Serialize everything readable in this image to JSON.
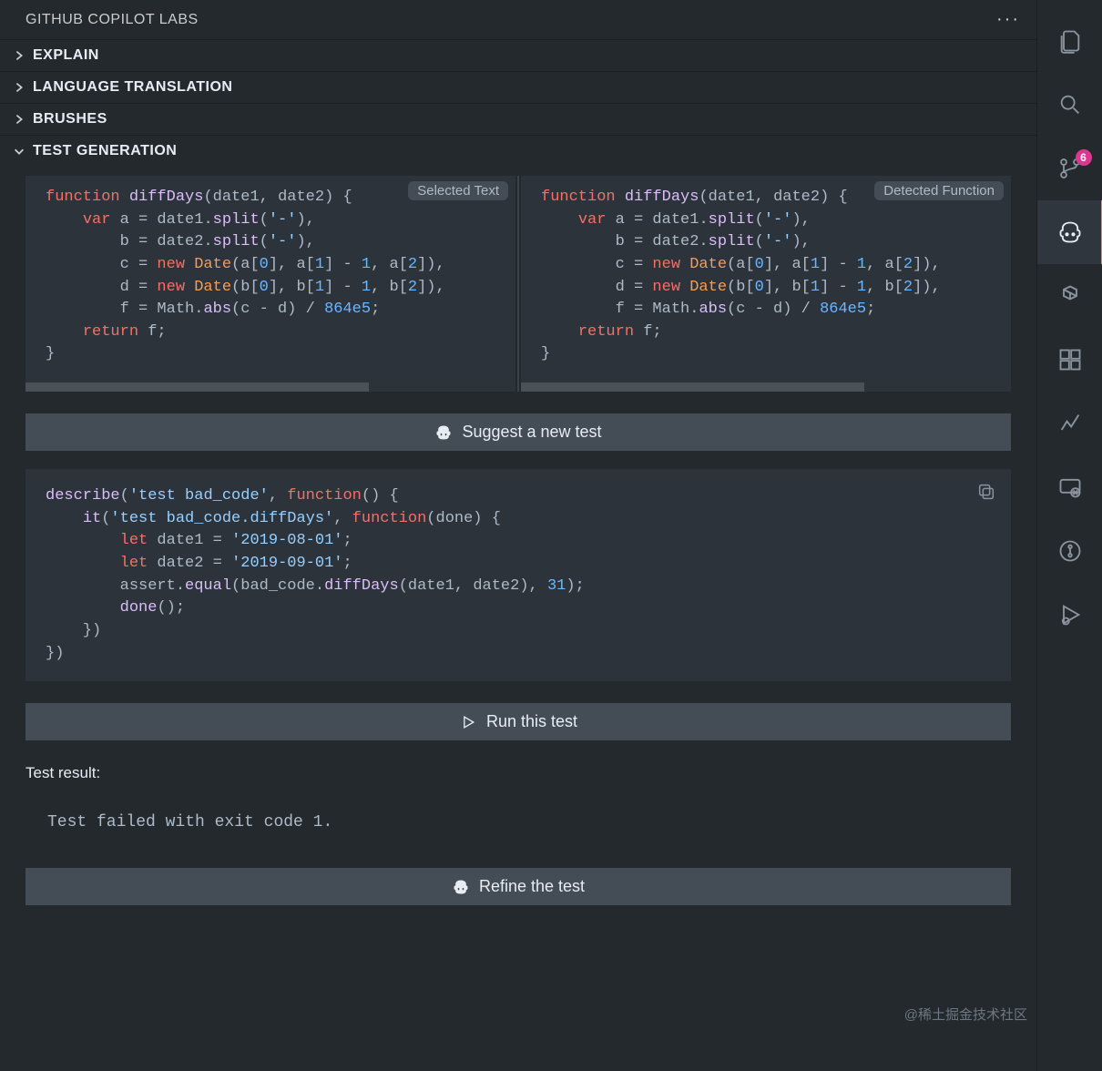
{
  "header": {
    "title": "GITHUB COPILOT LABS"
  },
  "sections": {
    "explain": "EXPLAIN",
    "language_translation": "LANGUAGE TRANSLATION",
    "brushes": "BRUSHES",
    "test_generation": "TEST GENERATION"
  },
  "code_panes": {
    "left": {
      "tag": "Selected Text",
      "code_html": "<span class='kw'>function</span> <span class='fn'>diffDays</span>(date1, date2) {\n    <span class='kw'>var</span> a = date1.<span class='fn'>split</span>(<span class='str'>'-'</span>),\n        b = date2.<span class='fn'>split</span>(<span class='str'>'-'</span>),\n        c = <span class='kw'>new</span> <span class='new'>Date</span>(a[<span class='num'>0</span>], a[<span class='num'>1</span>] - <span class='num'>1</span>, a[<span class='num'>2</span>]),\n        d = <span class='kw'>new</span> <span class='new'>Date</span>(b[<span class='num'>0</span>], b[<span class='num'>1</span>] - <span class='num'>1</span>, b[<span class='num'>2</span>]),\n        f = Math.<span class='fn'>abs</span>(c - d) / <span class='num'>864e5</span>;\n    <span class='kw'>return</span> f;\n}"
    },
    "right": {
      "tag": "Detected Function",
      "code_html": "<span class='kw'>function</span> <span class='fn'>diffDays</span>(date1, date2) {\n    <span class='kw'>var</span> a = date1.<span class='fn'>split</span>(<span class='str'>'-'</span>),\n        b = date2.<span class='fn'>split</span>(<span class='str'>'-'</span>),\n        c = <span class='kw'>new</span> <span class='new'>Date</span>(a[<span class='num'>0</span>], a[<span class='num'>1</span>] - <span class='num'>1</span>, a[<span class='num'>2</span>]),\n        d = <span class='kw'>new</span> <span class='new'>Date</span>(b[<span class='num'>0</span>], b[<span class='num'>1</span>] - <span class='num'>1</span>, b[<span class='num'>2</span>]),\n        f = Math.<span class='fn'>abs</span>(c - d) / <span class='num'>864e5</span>;\n    <span class='kw'>return</span> f;\n}"
    }
  },
  "buttons": {
    "suggest": "Suggest a new test",
    "run": "Run this test",
    "refine": "Refine the test"
  },
  "test_code_html": "<span class='fn'>describe</span>(<span class='str'>'test bad_code'</span>, <span class='kw'>function</span>() {\n    <span class='fn'>it</span>(<span class='str'>'test bad_code.diffDays'</span>, <span class='kw'>function</span>(done) {\n        <span class='kw'>let</span> date1 = <span class='str'>'2019-08-01'</span>;\n        <span class='kw'>let</span> date2 = <span class='str'>'2019-09-01'</span>;\n        assert.<span class='fn'>equal</span>(bad_code.<span class='fn'>diffDays</span>(date1, date2), <span class='num'>31</span>);\n        <span class='fn'>done</span>();\n    })\n})",
  "test_result": {
    "label": "Test result:",
    "text": "Test failed with exit code 1."
  },
  "sidebar": {
    "badge_count": "6",
    "items": [
      "files",
      "search",
      "source-control",
      "copilot",
      "openai",
      "extensions",
      "graph",
      "remote",
      "git-branch",
      "run-debug"
    ]
  },
  "watermark": "@稀土掘金技术社区"
}
